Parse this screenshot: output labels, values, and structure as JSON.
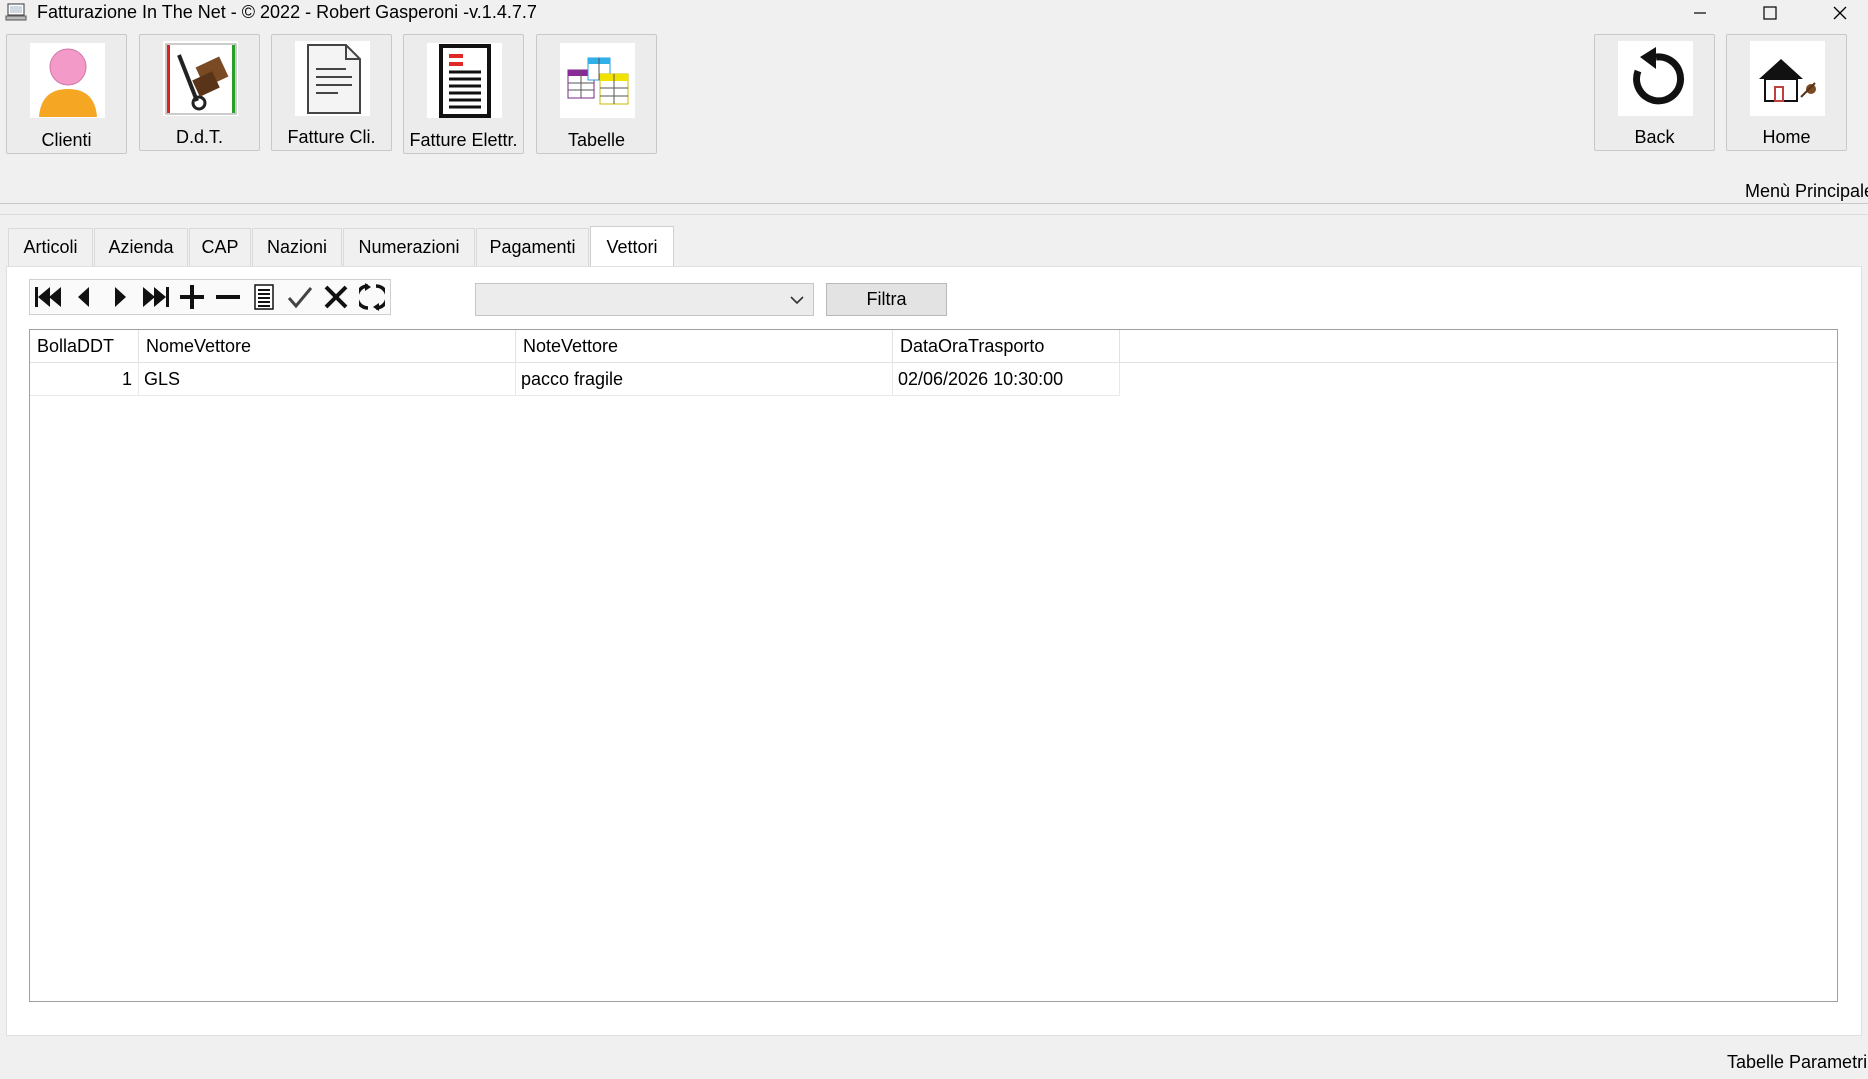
{
  "window": {
    "title": "Fatturazione In The Net - © 2022 - Robert Gasperoni -v.1.4.7.7",
    "minimize": "—",
    "maximize": "☐",
    "close": "✕"
  },
  "toolbar": {
    "clienti": "Clienti",
    "ddt": "D.d.T.",
    "fatture_cli": "Fatture Cli.",
    "fatture_elettr": "Fatture Elettr.",
    "tabelle": "Tabelle",
    "back": "Back",
    "home": "Home"
  },
  "menu_label": "Menù Principale",
  "tabs": [
    {
      "label": "Articoli"
    },
    {
      "label": "Azienda"
    },
    {
      "label": "CAP"
    },
    {
      "label": "Nazioni"
    },
    {
      "label": "Numerazioni"
    },
    {
      "label": "Pagamenti"
    },
    {
      "label": "Vettori"
    }
  ],
  "active_tab": "Vettori",
  "filter": {
    "selected": "",
    "button": "Filtra"
  },
  "grid": {
    "columns": [
      "BollaDDT",
      "NomeVettore",
      "NoteVettore",
      "DataOraTrasporto"
    ],
    "rows": [
      {
        "bolla": "1",
        "nome": "GLS",
        "note": "pacco fragile",
        "data": "02/06/2026 10:30:00"
      }
    ]
  },
  "status": "Tabelle Parametri",
  "colors": {
    "background": "#f0f0f0",
    "panel": "#ffffff",
    "border": "#a0a0a0"
  }
}
